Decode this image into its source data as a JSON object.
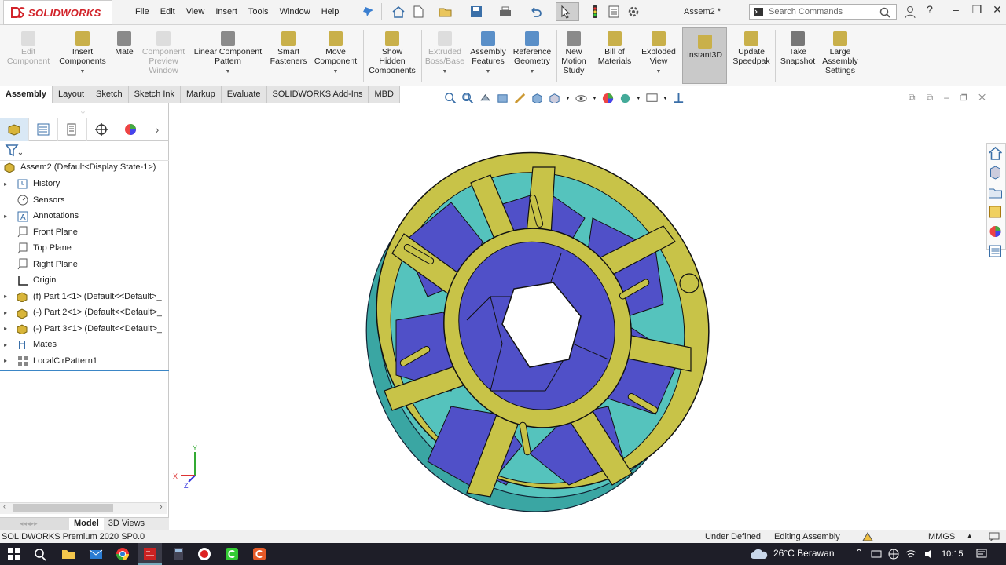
{
  "app": {
    "logo_text": "SOLIDWORKS",
    "document_title": "Assem2 *",
    "search_placeholder": "Search Commands",
    "menus": [
      "File",
      "Edit",
      "View",
      "Insert",
      "Tools",
      "Window",
      "Help"
    ]
  },
  "command_manager": {
    "edit_component": "Edit\nComponent",
    "insert_components": "Insert\nComponents",
    "mate": "Mate",
    "component_preview": "Component\nPreview\nWindow",
    "linear_pattern": "Linear Component\nPattern",
    "smart_fasteners": "Smart\nFasteners",
    "move_component": "Move\nComponent",
    "show_hidden": "Show\nHidden\nComponents",
    "extruded_boss": "Extruded\nBoss/Base",
    "assembly_features": "Assembly\nFeatures",
    "reference_geometry": "Reference\nGeometry",
    "new_motion_study": "New\nMotion\nStudy",
    "bill_of_materials": "Bill of\nMaterials",
    "exploded_view": "Exploded\nView",
    "instant3d": "Instant3D",
    "update_speedpak": "Update\nSpeedpak",
    "take_snapshot": "Take\nSnapshot",
    "large_assembly": "Large\nAssembly\nSettings"
  },
  "tabs": [
    "Assembly",
    "Layout",
    "Sketch",
    "Sketch Ink",
    "Markup",
    "Evaluate",
    "SOLIDWORKS Add-Ins",
    "MBD"
  ],
  "tree": {
    "root": "Assem2  (Default<Display State-1>)",
    "items": [
      {
        "label": "History",
        "expand": "▸"
      },
      {
        "label": "Sensors",
        "expand": ""
      },
      {
        "label": "Annotations",
        "expand": "▸"
      },
      {
        "label": "Front Plane",
        "expand": ""
      },
      {
        "label": "Top Plane",
        "expand": ""
      },
      {
        "label": "Right Plane",
        "expand": ""
      },
      {
        "label": "Origin",
        "expand": ""
      },
      {
        "label": "(f) Part 1<1> (Default<<Default>_",
        "expand": "▸"
      },
      {
        "label": "(-) Part 2<1> (Default<<Default>_",
        "expand": "▸"
      },
      {
        "label": "(-) Part 3<1> (Default<<Default>_",
        "expand": "▸"
      },
      {
        "label": "Mates",
        "expand": "▸"
      },
      {
        "label": "LocalCirPattern1",
        "expand": "▸"
      }
    ]
  },
  "bottom_tabs": [
    "Model",
    "3D Views"
  ],
  "triad": {
    "x_label": "X",
    "y_label": "Y",
    "z_label": "Z"
  },
  "status": {
    "product": "SOLIDWORKS Premium 2020 SP0.0",
    "definition": "Under Defined",
    "mode": "Editing Assembly",
    "units": "MMGS"
  },
  "taskbar": {
    "weather": "26°C  Berawan",
    "time": "10:15"
  },
  "colors": {
    "ring": "#c8c348",
    "base": "#3aa6a3",
    "blades": "#5050c8",
    "teal_inner": "#55c3bd"
  }
}
